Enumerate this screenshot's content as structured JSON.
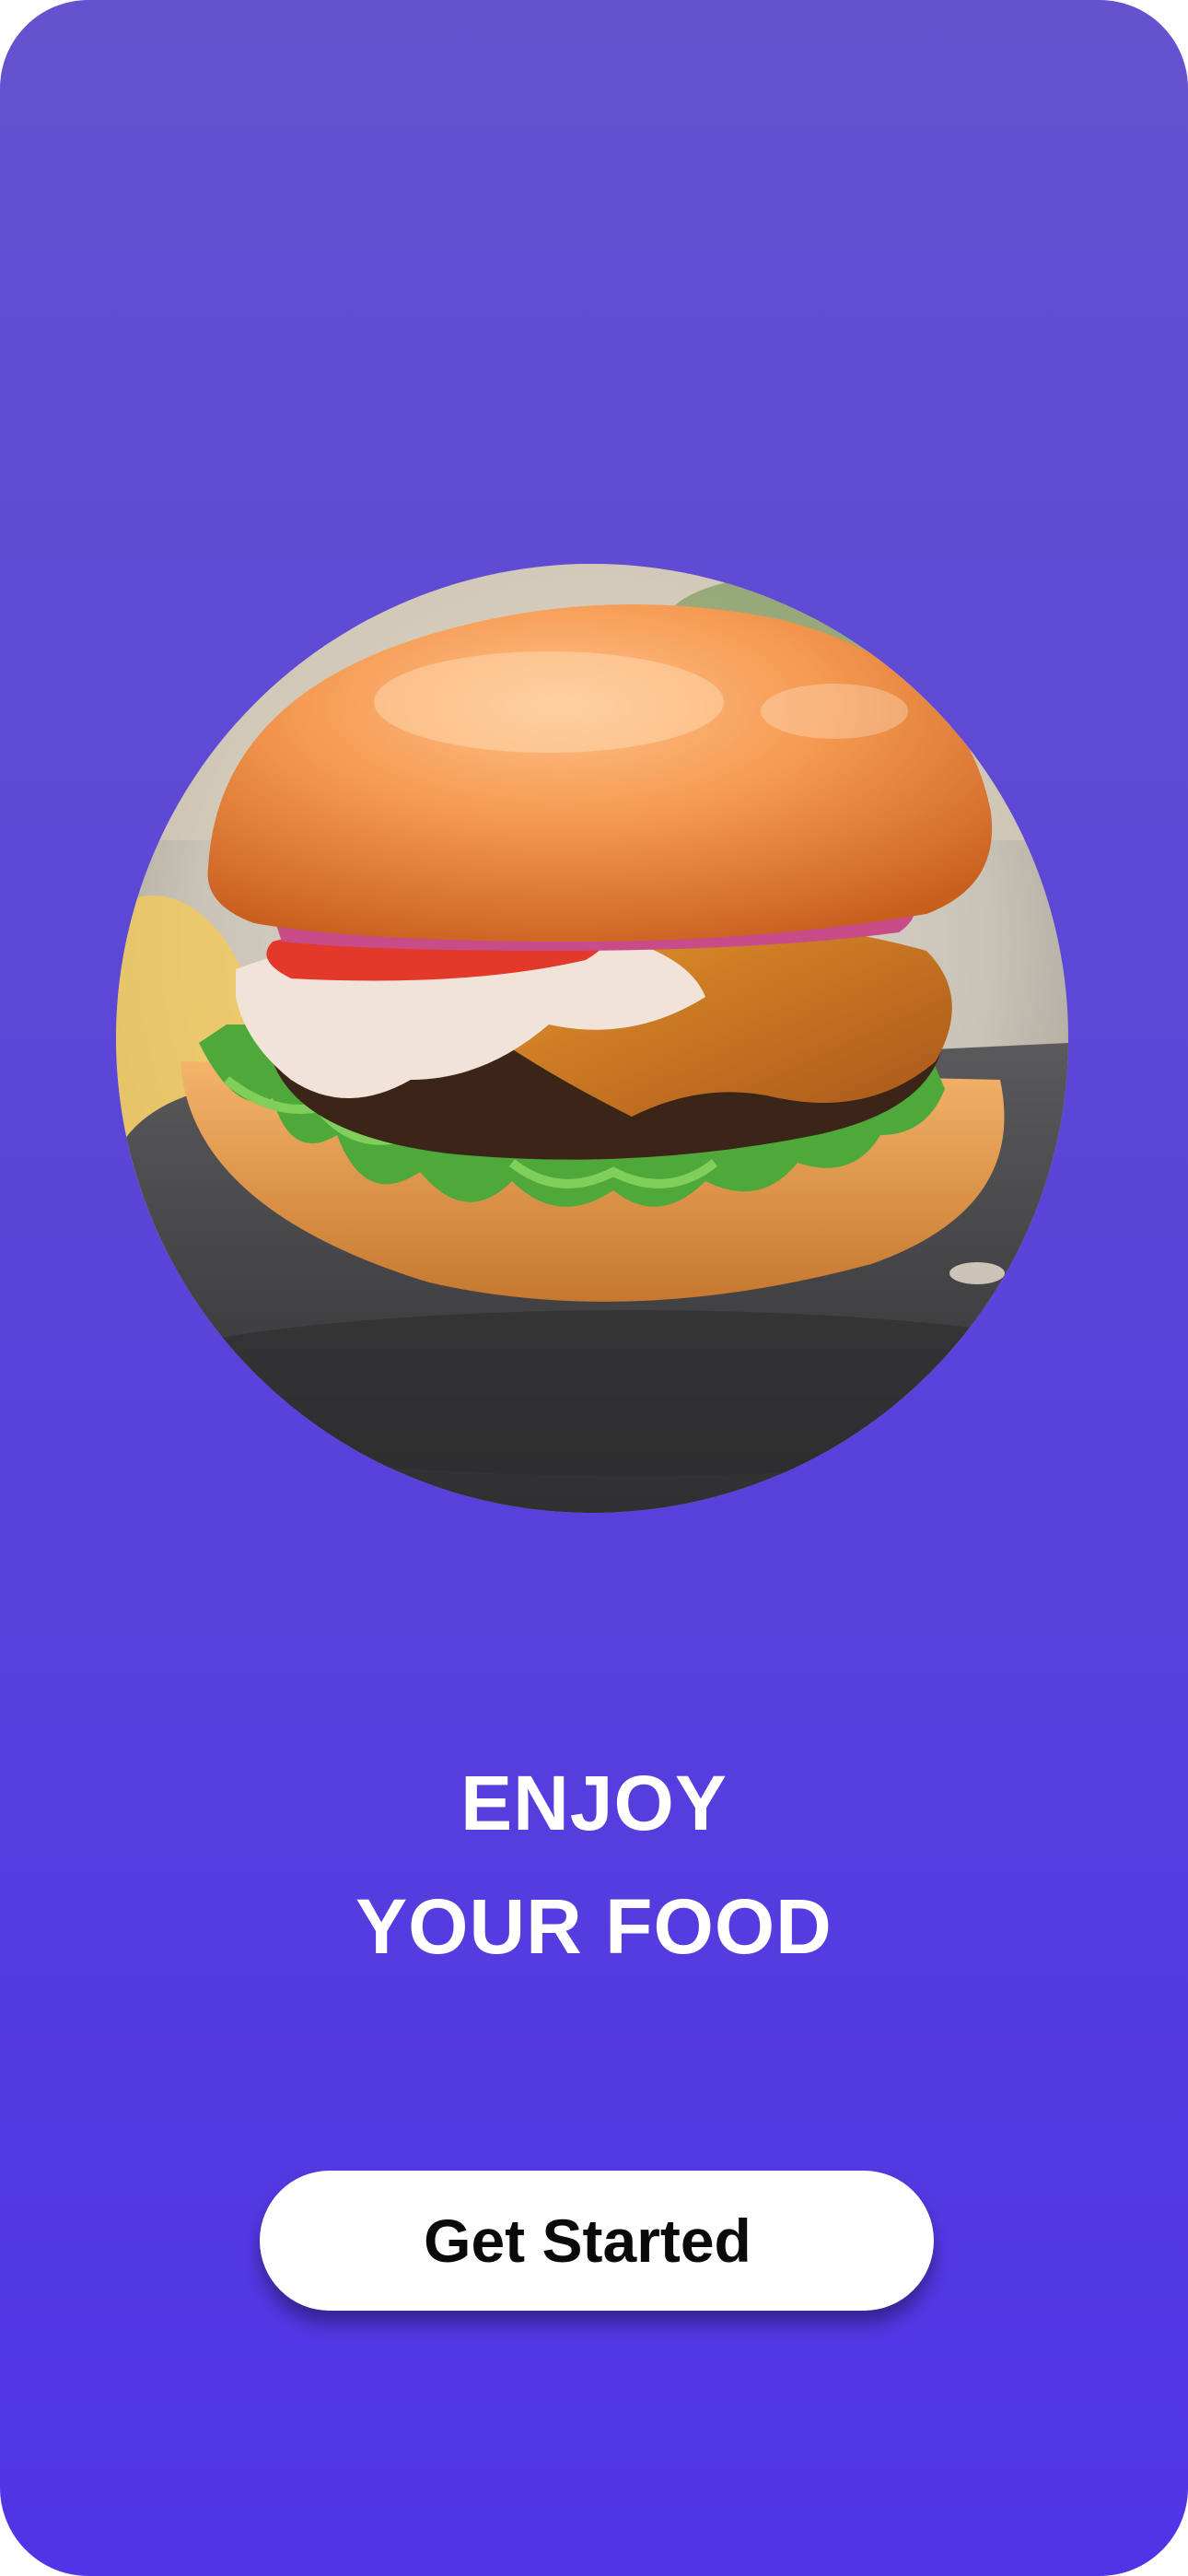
{
  "onboarding": {
    "headline_line1": "ENJOY",
    "headline_line2": "YOUR FOOD",
    "cta_label": "Get Started",
    "hero_image_icon": "burger-photo"
  },
  "colors": {
    "background_top": "#6452cf",
    "background_bottom": "#5034e6",
    "text": "#ffffff",
    "button_bg": "#ffffff",
    "button_text": "#0a0a0a"
  }
}
